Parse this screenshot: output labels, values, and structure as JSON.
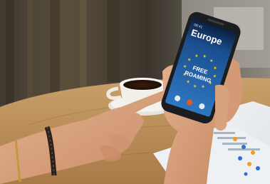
{
  "scene": {
    "alt": "Hands holding a smartphone showing a Europe free roaming screen, with a coffee cup and papers on a wooden table",
    "colors": {
      "background_wall": "#4a4236",
      "table_wood": "#b98a55",
      "phone_body": "#1c1d21",
      "screen_blue": "#1f5fa8",
      "eu_star_yellow": "#f2d21a",
      "skin": "#d7a07c",
      "cup_white": "#f1efe9",
      "coffee": "#2b160c"
    }
  },
  "phone_screen": {
    "title": "Europe",
    "subtitle": "FREE",
    "subtitle2": "ROAMING",
    "star_count": 12,
    "header_small": "09:41"
  }
}
